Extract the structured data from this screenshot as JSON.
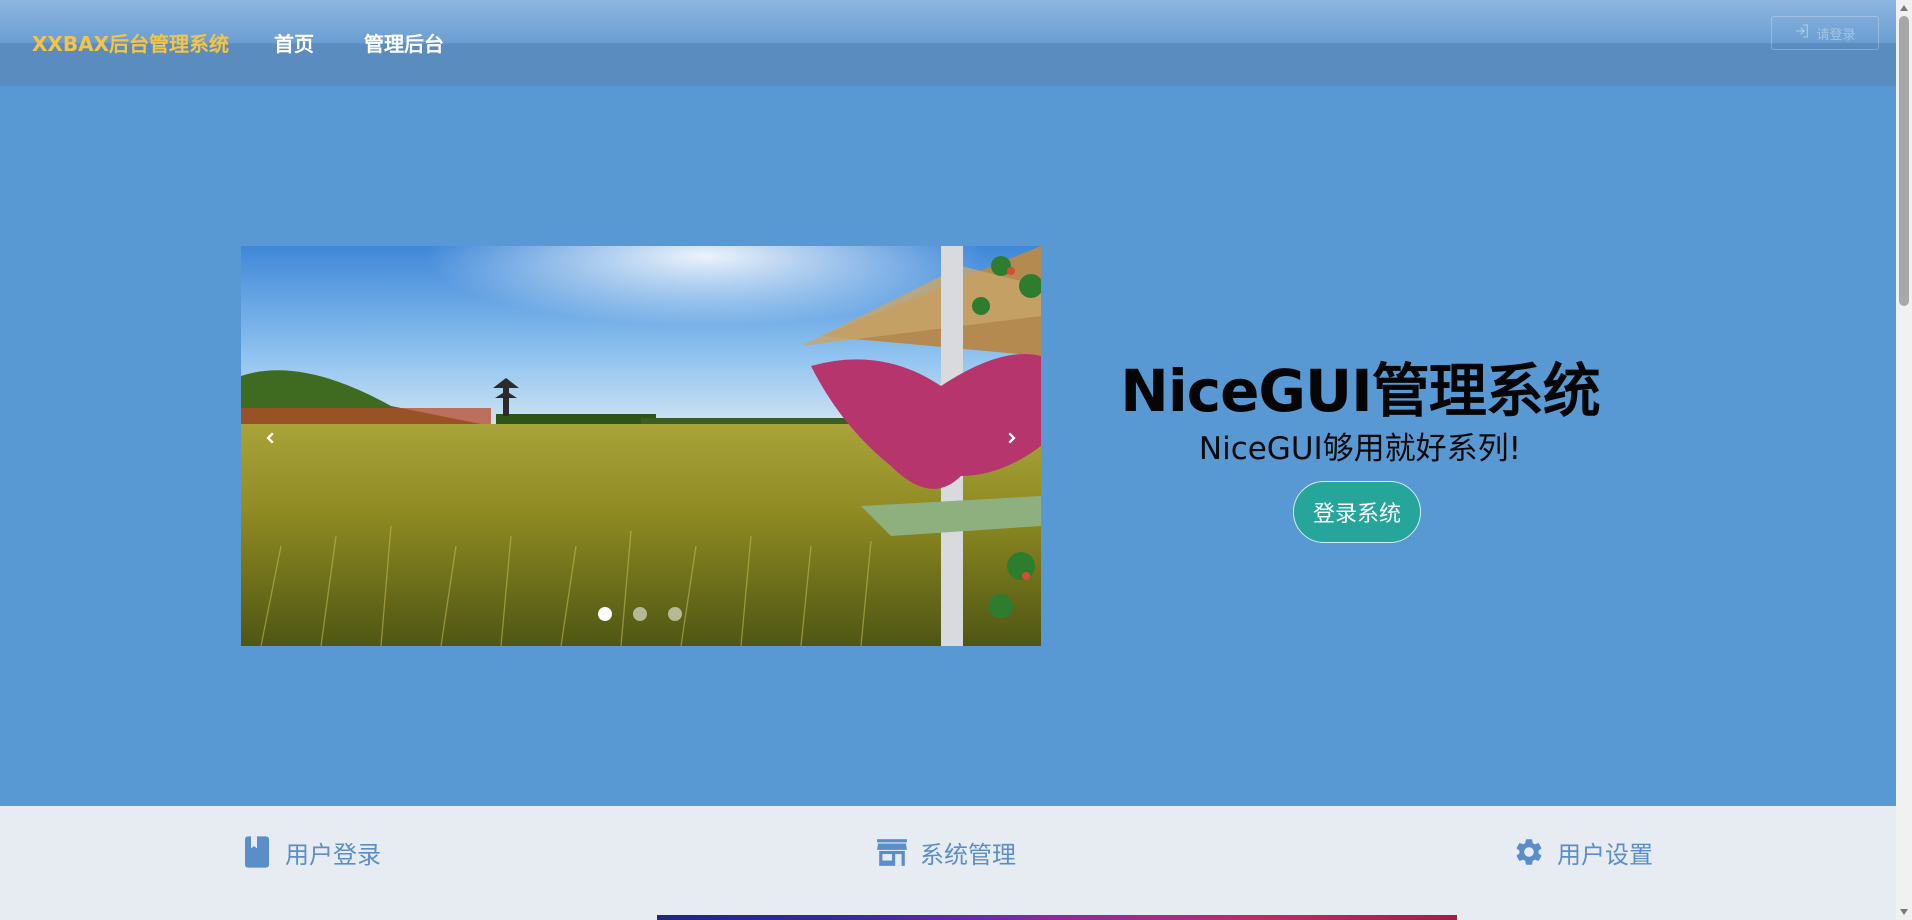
{
  "header": {
    "brand": "XXBAX后台管理系统",
    "nav": [
      "首页",
      "管理后台"
    ],
    "login_button": "请登录"
  },
  "hero": {
    "title": "NiceGUI管理系统",
    "subtitle": "NiceGUI够用就好系列!",
    "login_button": "登录系统"
  },
  "carousel": {
    "slide_count": 3,
    "active_slide": 1,
    "prev_icon": "chevron-left-icon",
    "next_icon": "chevron-right-icon"
  },
  "features": [
    {
      "label": "用户登录",
      "icon": "book-icon"
    },
    {
      "label": "系统管理",
      "icon": "store-icon"
    },
    {
      "label": "用户设置",
      "icon": "gear-icon"
    }
  ],
  "colors": {
    "header": "#5b8cc0",
    "hero_background": "#5898d3",
    "brand": "#f6c445",
    "login_button": "#26a69a",
    "feature_text": "#5b8ec8",
    "features_background": "#e7ecf3"
  }
}
